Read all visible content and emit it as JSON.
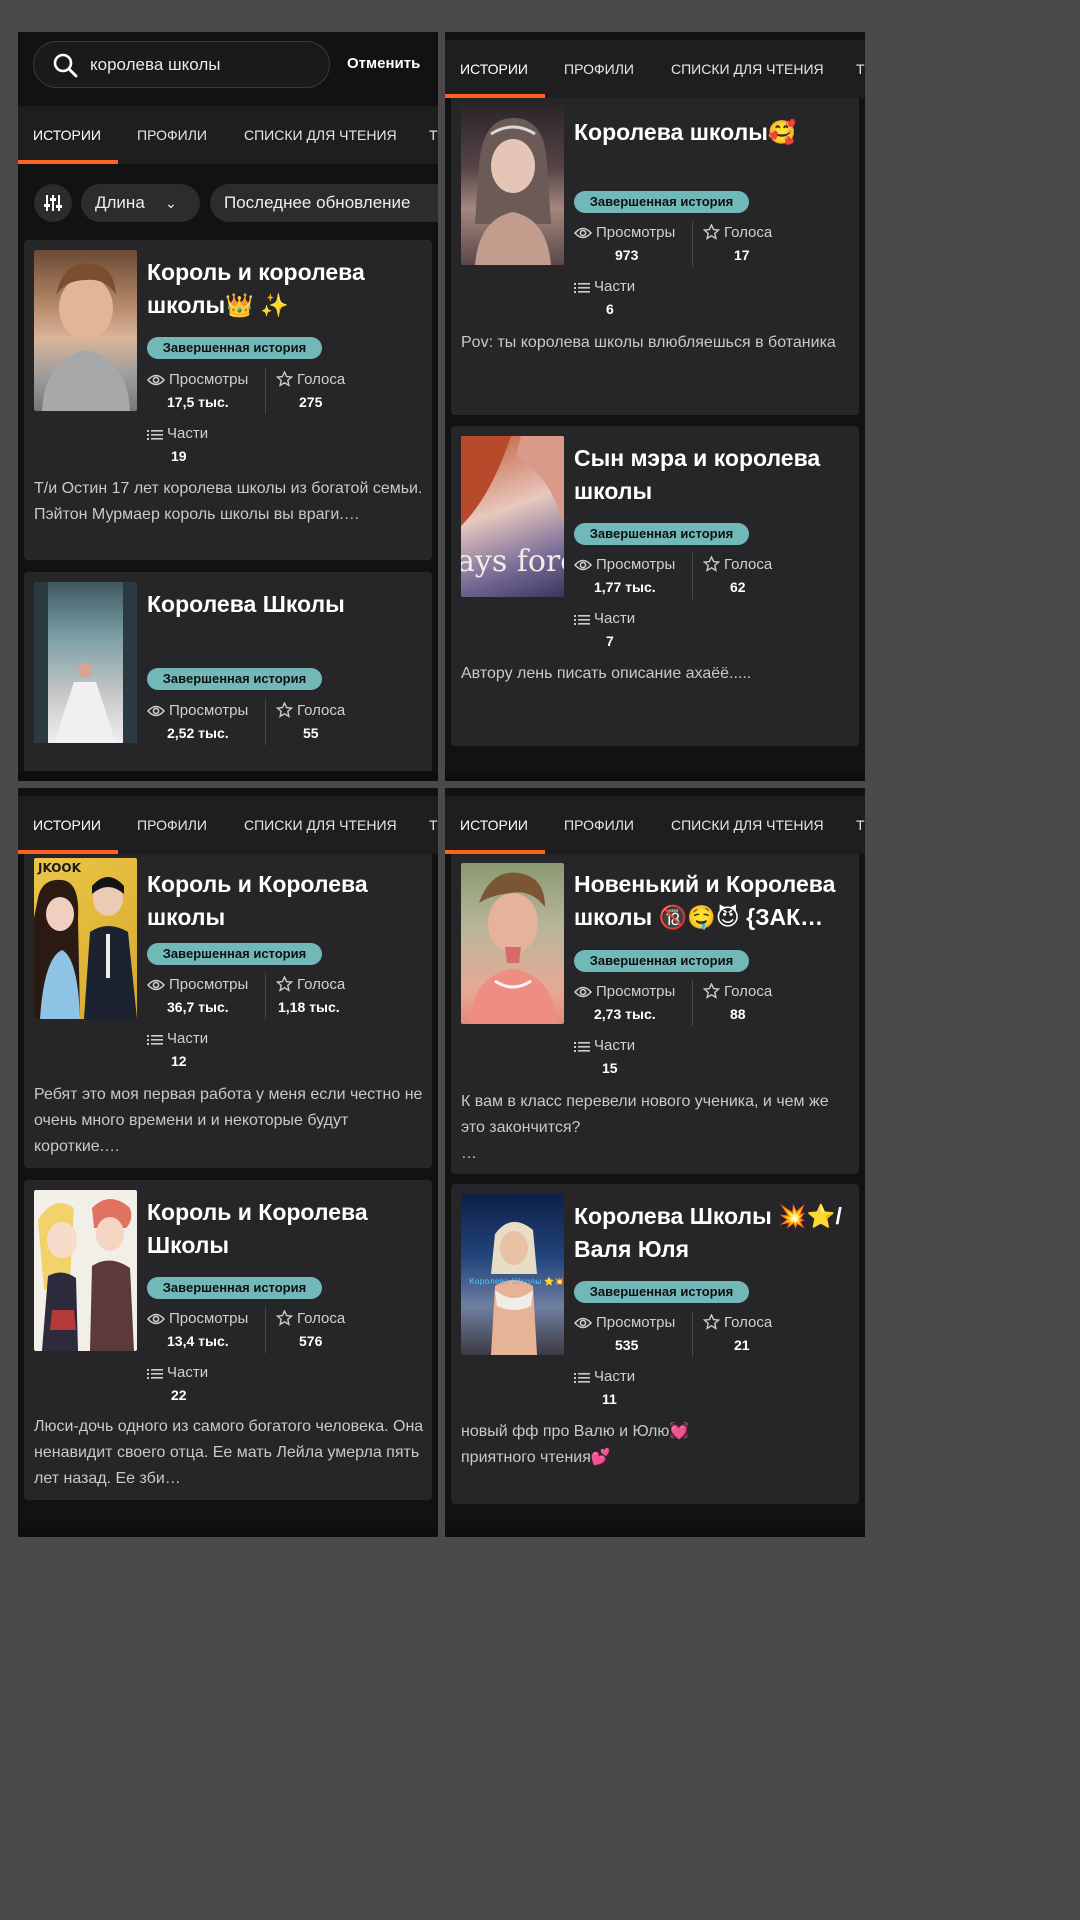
{
  "search": {
    "query": "королева школы",
    "cancel_label": "Отменить"
  },
  "tabs": [
    "ИСТОРИИ",
    "ПРОФИЛИ",
    "СПИСКИ ДЛЯ ЧТЕНИЯ",
    "Т"
  ],
  "filters": {
    "length_label": "Длина",
    "updated_label": "Последнее обновление"
  },
  "labels": {
    "views": "Просмотры",
    "votes": "Голоса",
    "parts": "Части",
    "completed": "Завершенная история"
  },
  "colors": {
    "accent": "#ff6122",
    "badge": "#73b8b9",
    "card": "#262528"
  },
  "panel1": {
    "stories": [
      {
        "title": "Король и королева школы👑 ✨",
        "views": "17,5 тыс.",
        "votes": "275",
        "parts": "19",
        "description": "Т/и  Остин 17 лет королева школы из богатой семьи. Пэйтон Мурмаер  король школы вы враги.…"
      },
      {
        "title": "Королева Школы",
        "views": "2,52 тыс.",
        "votes": "55"
      }
    ]
  },
  "panel2": {
    "stories": [
      {
        "title": "Королева школы🥰",
        "views": "973",
        "votes": "17",
        "parts": "6",
        "description": "Pov: ты королева школы влюбляешься в ботаника"
      },
      {
        "title": "Сын мэра и королева школы",
        "views": "1,77 тыс.",
        "votes": "62",
        "parts": "7",
        "description": "Автору лень писать описание ахаёё.....",
        "cover_text": "ays fore"
      }
    ]
  },
  "panel3": {
    "stories": [
      {
        "title": "Король и Королева школы",
        "views": "36,7 тыс.",
        "votes": "1,18 тыс.",
        "parts": "12",
        "description": "Ребят это моя первая работа у меня если честно не очень много времени и и некоторые будут короткие.…",
        "cover_text": "JKOOK"
      },
      {
        "title": "Король и Королева Школы",
        "views": "13,4 тыс.",
        "votes": "576",
        "parts": "22",
        "description": "Люси-дочь одного из самого богатого человека. Она ненавидит своего отца. Ее мать Лейла умерла пять лет назад. Ее зби…"
      }
    ]
  },
  "panel4": {
    "stories": [
      {
        "title": "Новенький и Королева школы 🔞🤤😈 {ЗАК…",
        "views": "2,73 тыс.",
        "votes": "88",
        "parts": "15",
        "description": "К вам в класс перевели нового ученика, и чем же это закончится?\n…"
      },
      {
        "title": "Королева Школы 💥⭐/Валя Юля",
        "views": "535",
        "votes": "21",
        "parts": "11",
        "description": "новый фф про Валю и Юлю💓\nприятного чтения💕",
        "cover_text": "Королева Школы ⭐💥"
      }
    ]
  }
}
